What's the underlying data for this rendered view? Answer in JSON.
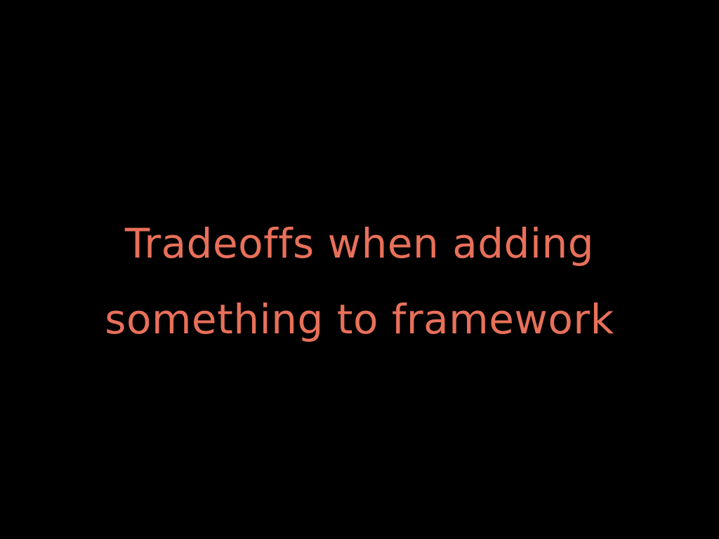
{
  "slide": {
    "background_color": "#000000",
    "text_color": "#E8705A",
    "title_lines": [
      "Tradeoffs when adding",
      "something to framework"
    ]
  }
}
